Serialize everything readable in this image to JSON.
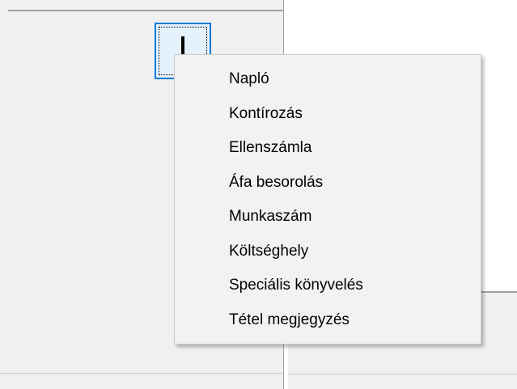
{
  "context_menu": {
    "items": [
      {
        "label": "Napló"
      },
      {
        "label": "Kontírozás"
      },
      {
        "label": "Ellenszámla"
      },
      {
        "label": "Áfa besorolás"
      },
      {
        "label": "Munkaszám"
      },
      {
        "label": "Költséghely"
      },
      {
        "label": "Speciális könyvelés"
      },
      {
        "label": "Tétel megjegyzés"
      }
    ]
  },
  "colors": {
    "focus_border": "#0078d7",
    "menu_background": "#f2f2f2",
    "panel_background": "#f0f0f0"
  }
}
